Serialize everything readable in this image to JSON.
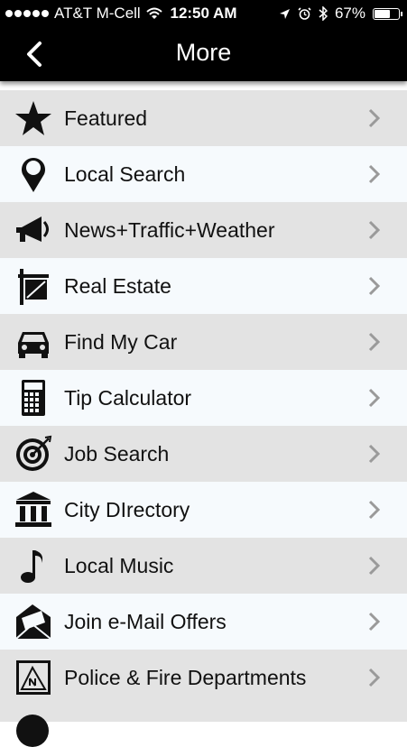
{
  "status_bar": {
    "carrier": "AT&T M-Cell",
    "time": "12:50 AM",
    "battery_percent": "67%",
    "battery_level": 0.67
  },
  "nav": {
    "title": "More",
    "back_icon": "chevron-left-icon"
  },
  "menu": {
    "items": [
      {
        "label": "Featured",
        "icon": "star-icon"
      },
      {
        "label": "Local Search",
        "icon": "map-pin-icon"
      },
      {
        "label": "News+Traffic+Weather",
        "icon": "megaphone-icon"
      },
      {
        "label": "Real Estate",
        "icon": "real-estate-sign-icon"
      },
      {
        "label": "Find My Car",
        "icon": "car-icon"
      },
      {
        "label": "Tip Calculator",
        "icon": "calculator-icon"
      },
      {
        "label": "Job Search",
        "icon": "target-icon"
      },
      {
        "label": "City DIrectory",
        "icon": "city-hall-icon"
      },
      {
        "label": "Local Music",
        "icon": "music-note-icon"
      },
      {
        "label": "Join e-Mail Offers",
        "icon": "envelope-icon"
      },
      {
        "label": "Police & Fire Departments",
        "icon": "badge-icon"
      }
    ]
  },
  "colors": {
    "bar_background": "#000000",
    "row_gray": "#e3e3e3",
    "row_white": "#f6fafd",
    "chevron": "#9a9a9a"
  }
}
